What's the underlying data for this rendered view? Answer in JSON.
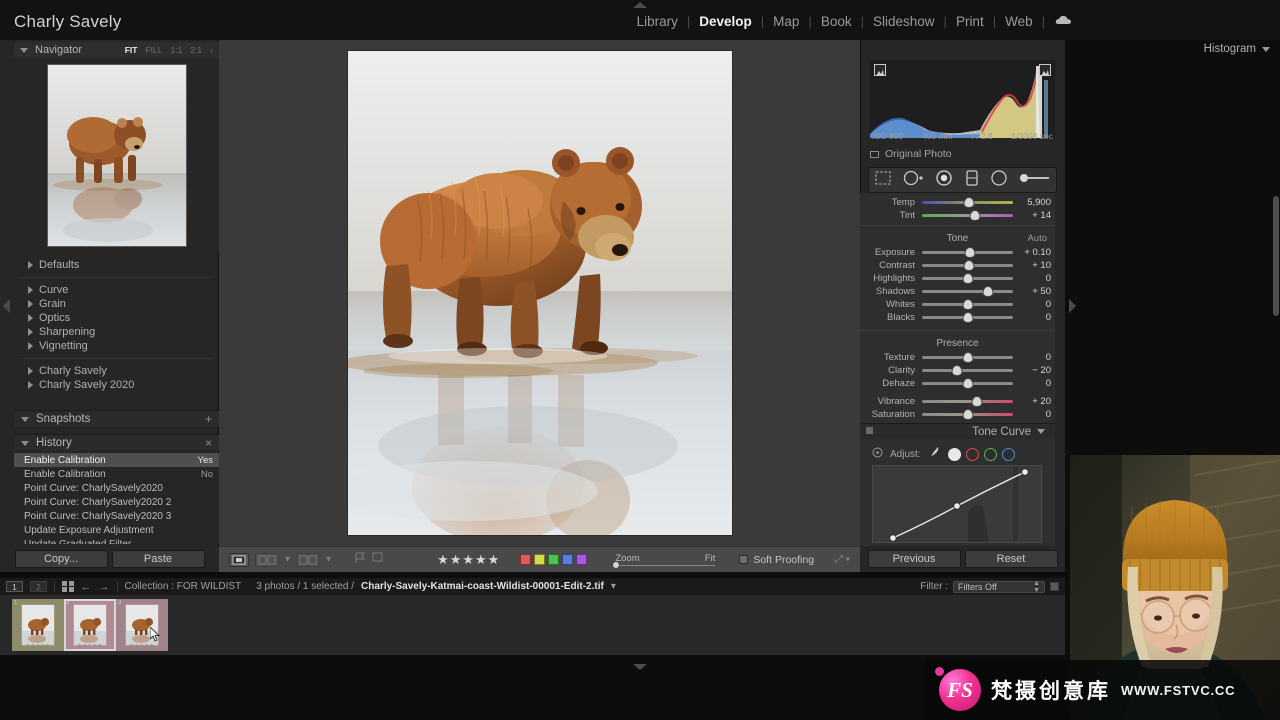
{
  "app": {
    "identity": "Charly Savely",
    "modules": [
      {
        "label": "Library",
        "active": false
      },
      {
        "label": "Develop",
        "active": true
      },
      {
        "label": "Map",
        "active": false
      },
      {
        "label": "Book",
        "active": false
      },
      {
        "label": "Slideshow",
        "active": false
      },
      {
        "label": "Print",
        "active": false
      },
      {
        "label": "Web",
        "active": false
      }
    ],
    "cloud_icon": "cloud-icon",
    "separator": "|"
  },
  "navigator": {
    "title": "Navigator",
    "zoom_levels": [
      {
        "label": "FIT",
        "active": true
      },
      {
        "label": "FILL",
        "active": false
      },
      {
        "label": "1:1",
        "active": false
      },
      {
        "label": "2:1",
        "active": false
      }
    ],
    "chevron": "‹"
  },
  "presets": {
    "groups_top": [
      {
        "label": "Defaults"
      }
    ],
    "groups_mid": [
      {
        "label": "Curve"
      },
      {
        "label": "Grain"
      },
      {
        "label": "Optics"
      },
      {
        "label": "Sharpening"
      },
      {
        "label": "Vignetting"
      }
    ],
    "groups_user": [
      {
        "label": "Charly Savely"
      },
      {
        "label": "Charly Savely 2020"
      }
    ]
  },
  "snapshots": {
    "title": "Snapshots",
    "add_label": "+"
  },
  "history": {
    "title": "History",
    "clear_label": "×",
    "items": [
      {
        "label": "Enable Calibration",
        "value": "Yes",
        "selected": true
      },
      {
        "label": "Enable Calibration",
        "value": "No",
        "selected": false
      },
      {
        "label": "Point Curve: CharlySavely2020",
        "value": "",
        "selected": false
      },
      {
        "label": "Point Curve: CharlySavely2020 2",
        "value": "",
        "selected": false
      },
      {
        "label": "Point Curve: CharlySavely2020 3",
        "value": "",
        "selected": false
      },
      {
        "label": "Update Exposure Adjustment",
        "value": "",
        "selected": false
      },
      {
        "label": "Update Graduated Filter",
        "value": "",
        "selected": false
      }
    ]
  },
  "left_footer": {
    "copy_label": "Copy...",
    "paste_label": "Paste"
  },
  "right_footer": {
    "previous_label": "Previous",
    "reset_label": "Reset"
  },
  "histogram": {
    "title": "Histogram",
    "shadow_clip_icon": "shadow-clipping-icon",
    "highlight_clip_icon": "highlight-clipping-icon",
    "iso": "ISO 800",
    "focal": "400 mm",
    "aperture": "f / 2.8",
    "shutter": "1/3200 sec",
    "original_photo": "Original Photo"
  },
  "tools": [
    {
      "name": "crop-overlay-tool"
    },
    {
      "name": "spot-removal-tool"
    },
    {
      "name": "red-eye-correction-tool"
    },
    {
      "name": "graduated-filter-tool"
    },
    {
      "name": "radial-filter-tool"
    },
    {
      "name": "adjustment-brush-tool"
    }
  ],
  "basic": {
    "wb_sliders": [
      {
        "label": "Temp",
        "value": "5,900",
        "pos": 52,
        "type": "temp"
      },
      {
        "label": "Tint",
        "value": "+ 14",
        "pos": 58,
        "type": "tint"
      }
    ],
    "tone_title": "Tone",
    "auto_label": "Auto",
    "tone_sliders": [
      {
        "label": "Exposure",
        "value": "+ 0.10",
        "pos": 53
      },
      {
        "label": "Contrast",
        "value": "+ 10",
        "pos": 52
      },
      {
        "label": "Highlights",
        "value": "0",
        "pos": 50
      },
      {
        "label": "Shadows",
        "value": "+ 50",
        "pos": 72
      },
      {
        "label": "Whites",
        "value": "0",
        "pos": 50
      },
      {
        "label": "Blacks",
        "value": "0",
        "pos": 50
      }
    ],
    "presence_title": "Presence",
    "presence_sliders": [
      {
        "label": "Texture",
        "value": "0",
        "pos": 50
      },
      {
        "label": "Clarity",
        "value": "− 20",
        "pos": 38
      },
      {
        "label": "Dehaze",
        "value": "0",
        "pos": 50
      }
    ],
    "color_sliders": [
      {
        "label": "Vibrance",
        "value": "+ 20",
        "pos": 60,
        "type": "vibrance"
      },
      {
        "label": "Saturation",
        "value": "0",
        "pos": 50,
        "type": "saturation"
      }
    ]
  },
  "tone_curve": {
    "title": "Tone Curve",
    "adjust_label": "Adjust:",
    "target_icon": "target-adjustment-icon",
    "pen_icon": "point-curve-pen-icon",
    "channels": [
      {
        "name": "channel-rgb",
        "color": "#e8e8e8"
      },
      {
        "name": "channel-red",
        "color": "#d84a4a"
      },
      {
        "name": "channel-green",
        "color": "#4fb84f"
      },
      {
        "name": "channel-blue",
        "color": "#4a8ed8"
      }
    ]
  },
  "center_toolbar": {
    "loupe_view_icon": "loupe-view-icon",
    "compare_view_icon": "compare-view-icon",
    "survey_view_icon": "survey-view-icon",
    "flag_icon": "flag-pick-icon",
    "reject_icon": "flag-reject-icon",
    "stars": "★★★★★",
    "star_count": 5,
    "color_labels": [
      {
        "name": "label-red",
        "color": "#e05a5a"
      },
      {
        "name": "label-yellow",
        "color": "#d8d84a"
      },
      {
        "name": "label-green",
        "color": "#4ec44e"
      },
      {
        "name": "label-blue",
        "color": "#5a7fe0"
      },
      {
        "name": "label-purple",
        "color": "#a95ae0"
      }
    ],
    "zoom_label": "Zoom",
    "zoom_value": "Fit",
    "soft_proofing": "Soft Proofing"
  },
  "filmstrip_bar": {
    "screen1": "1",
    "screen2": "2",
    "grid_icon": "grid-view-icon",
    "back_arrow": "←",
    "forward_arrow": "→",
    "collection": "Collection : FOR WILDIST",
    "count": "3 photos / 1 selected /",
    "filename": "Charly-Savely-Katmai-coast-Wildist-00001-Edit-2.tif",
    "filename_caret": "▾",
    "filter_label": "Filter :",
    "filter_value": "Filters Off"
  },
  "filmstrip": {
    "thumbs": [
      {
        "index": "1",
        "tint": "#8d8b6a",
        "selected": false,
        "stars": "★★★★★"
      },
      {
        "index": "2",
        "tint": "#b08a93",
        "selected": true,
        "stars": "★★★★★"
      },
      {
        "index": "3",
        "tint": "#a08489",
        "selected": false,
        "stars": "★★★★★"
      }
    ]
  },
  "watermark": {
    "logo_text": "FS",
    "brand_cn": "梵摄创意库",
    "url": "WWW.FSTVC.CC"
  },
  "colors": {
    "panel_bg": "#262626",
    "canvas_bg": "#3a3a3a",
    "accent": "#f0338f",
    "selected_row": "#4f4f4f"
  }
}
